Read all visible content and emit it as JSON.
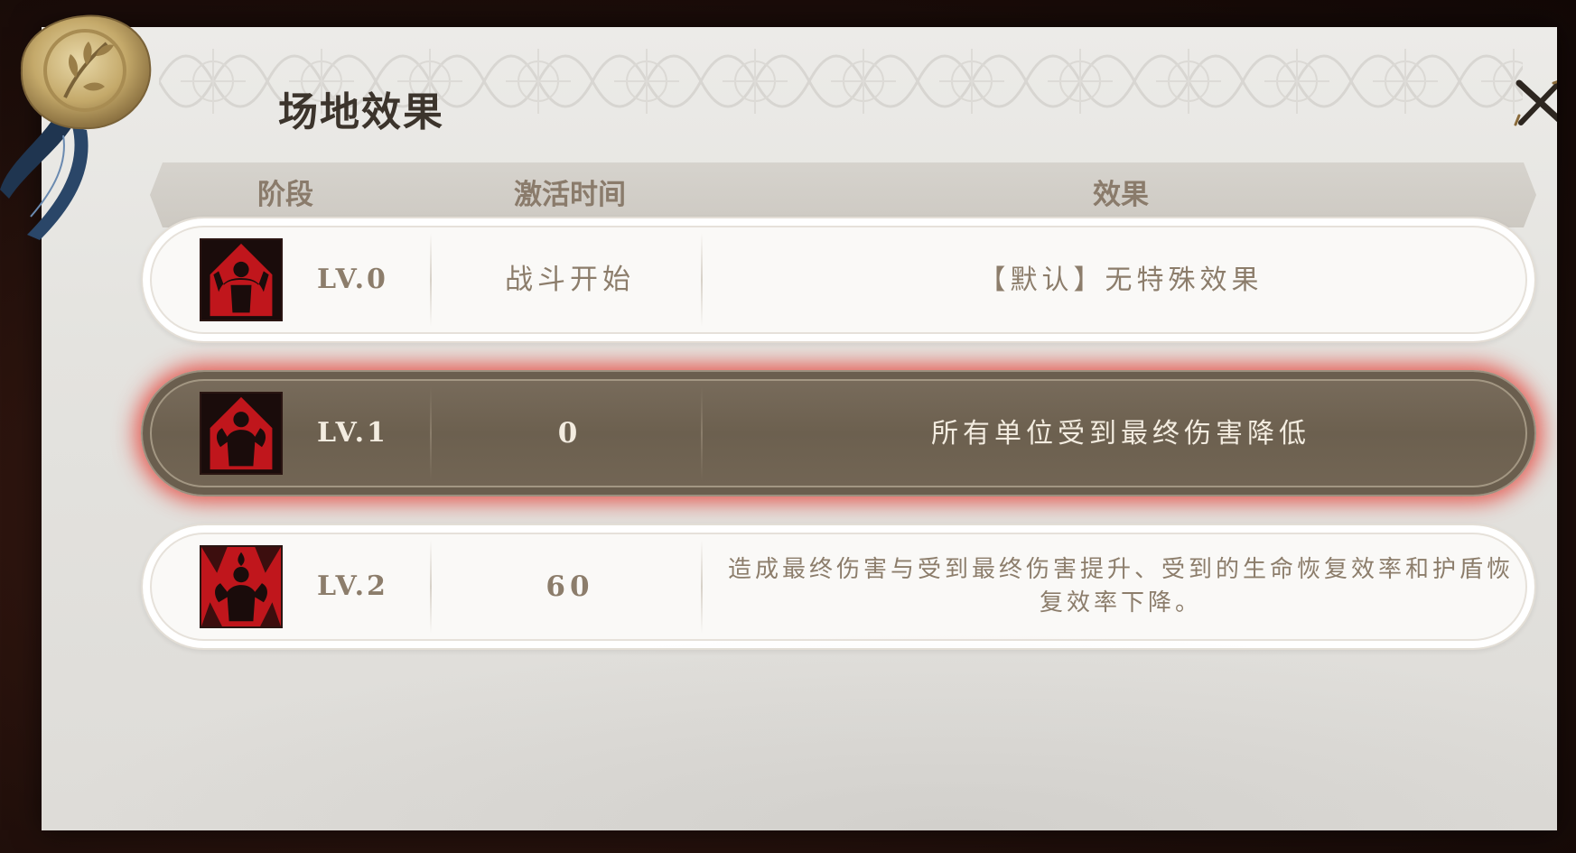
{
  "panel": {
    "title": "场地效果",
    "close_icon": "close-x-icon",
    "seal_icon": "wax-seal-icon"
  },
  "table": {
    "headers": {
      "stage": "阶段",
      "activation_time": "激活时间",
      "effect": "效果"
    },
    "rows": [
      {
        "level": "LV.0",
        "time": "战斗开始",
        "effect": "【默认】无特殊效果",
        "icon": "raised-arms-figure-icon",
        "selected": false
      },
      {
        "level": "LV.1",
        "time": "0",
        "effect": "所有单位受到最终伤害降低",
        "icon": "flexing-figure-icon",
        "selected": true
      },
      {
        "level": "LV.2",
        "time": "60",
        "effect": "造成最终伤害与受到最终伤害提升、受到的生命恢复效率和护盾恢复效率下降。",
        "icon": "burning-figure-icon",
        "selected": false
      }
    ]
  },
  "colors": {
    "accent_red": "#b8141a",
    "selected_row": "#6f6352",
    "text_brown": "#8c7d6b",
    "glow": "#e6281e"
  }
}
